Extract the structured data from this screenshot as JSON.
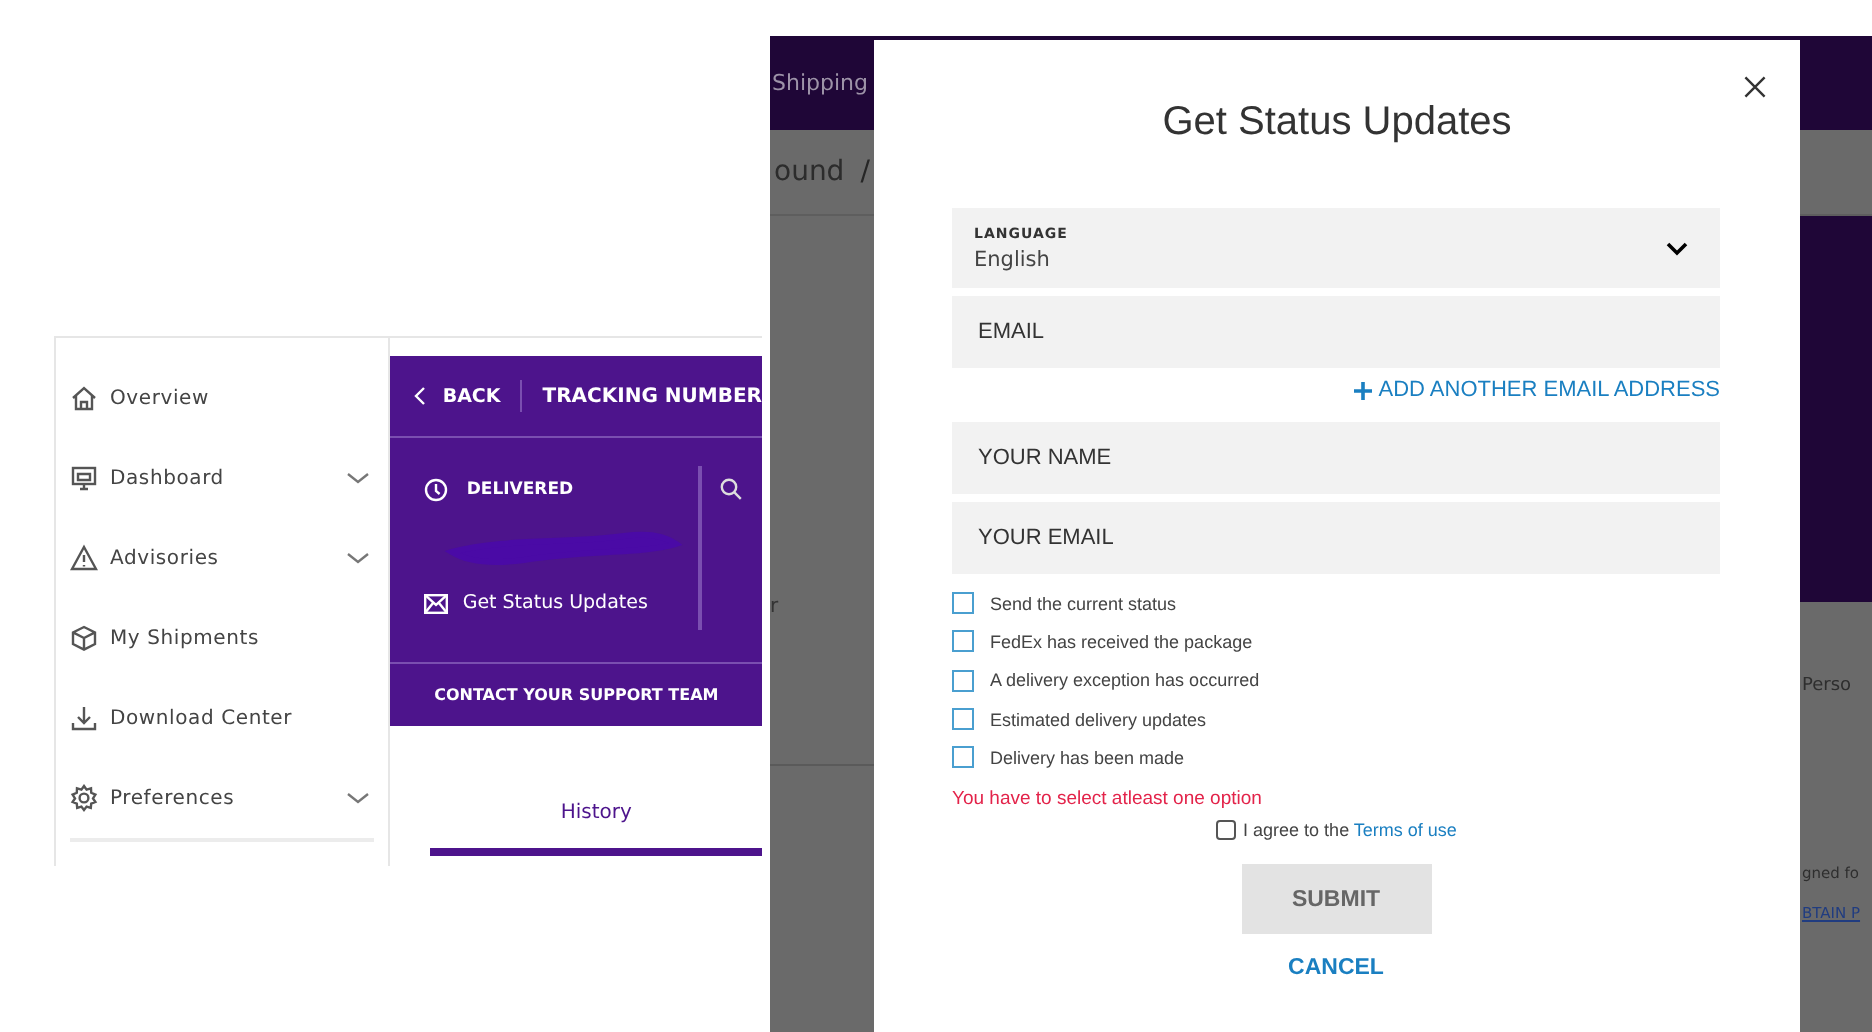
{
  "sidebar": {
    "items": [
      {
        "label": "Overview",
        "expandable": false
      },
      {
        "label": "Dashboard",
        "expandable": true
      },
      {
        "label": "Advisories",
        "expandable": true
      },
      {
        "label": "My Shipments",
        "expandable": false
      },
      {
        "label": "Download Center",
        "expandable": false
      },
      {
        "label": "Preferences",
        "expandable": true
      }
    ]
  },
  "tracking_card": {
    "back": "BACK",
    "title": "TRACKING NUMBER",
    "status": "DELIVERED",
    "action": "Get Status Updates",
    "contact": "CONTACT YOUR SUPPORT TEAM"
  },
  "tabs": [
    {
      "label": "History",
      "selected": true
    }
  ],
  "background_page": {
    "nav_item": "Shipping",
    "breadcrumb": "ound",
    "breadcrumb_separator": "/",
    "fragment_left": "r",
    "fragment_column": "Perso",
    "fragment_text": "gned fo",
    "fragment_link": "BTAIN P"
  },
  "modal": {
    "title": "Get Status Updates",
    "language": {
      "label": "LANGUAGE",
      "value": "English"
    },
    "email_field": {
      "placeholder": "EMAIL"
    },
    "add_email": "ADD ANOTHER EMAIL ADDRESS",
    "fields": [
      {
        "placeholder": "YOUR NAME"
      },
      {
        "placeholder": "YOUR EMAIL"
      }
    ],
    "options": [
      {
        "label": "Send the current status",
        "checked": false
      },
      {
        "label": "FedEx has received the package",
        "checked": false
      },
      {
        "label": "A delivery exception has occurred",
        "checked": false
      },
      {
        "label": "Estimated delivery updates",
        "checked": false
      },
      {
        "label": "Delivery has been made",
        "checked": false
      }
    ],
    "error": "You have to select atleast one option",
    "agree": {
      "text": "I agree to the",
      "link": "Terms of use",
      "checked": false
    },
    "submit": {
      "label": "SUBMIT",
      "disabled": true
    },
    "cancel": "CANCEL"
  }
}
